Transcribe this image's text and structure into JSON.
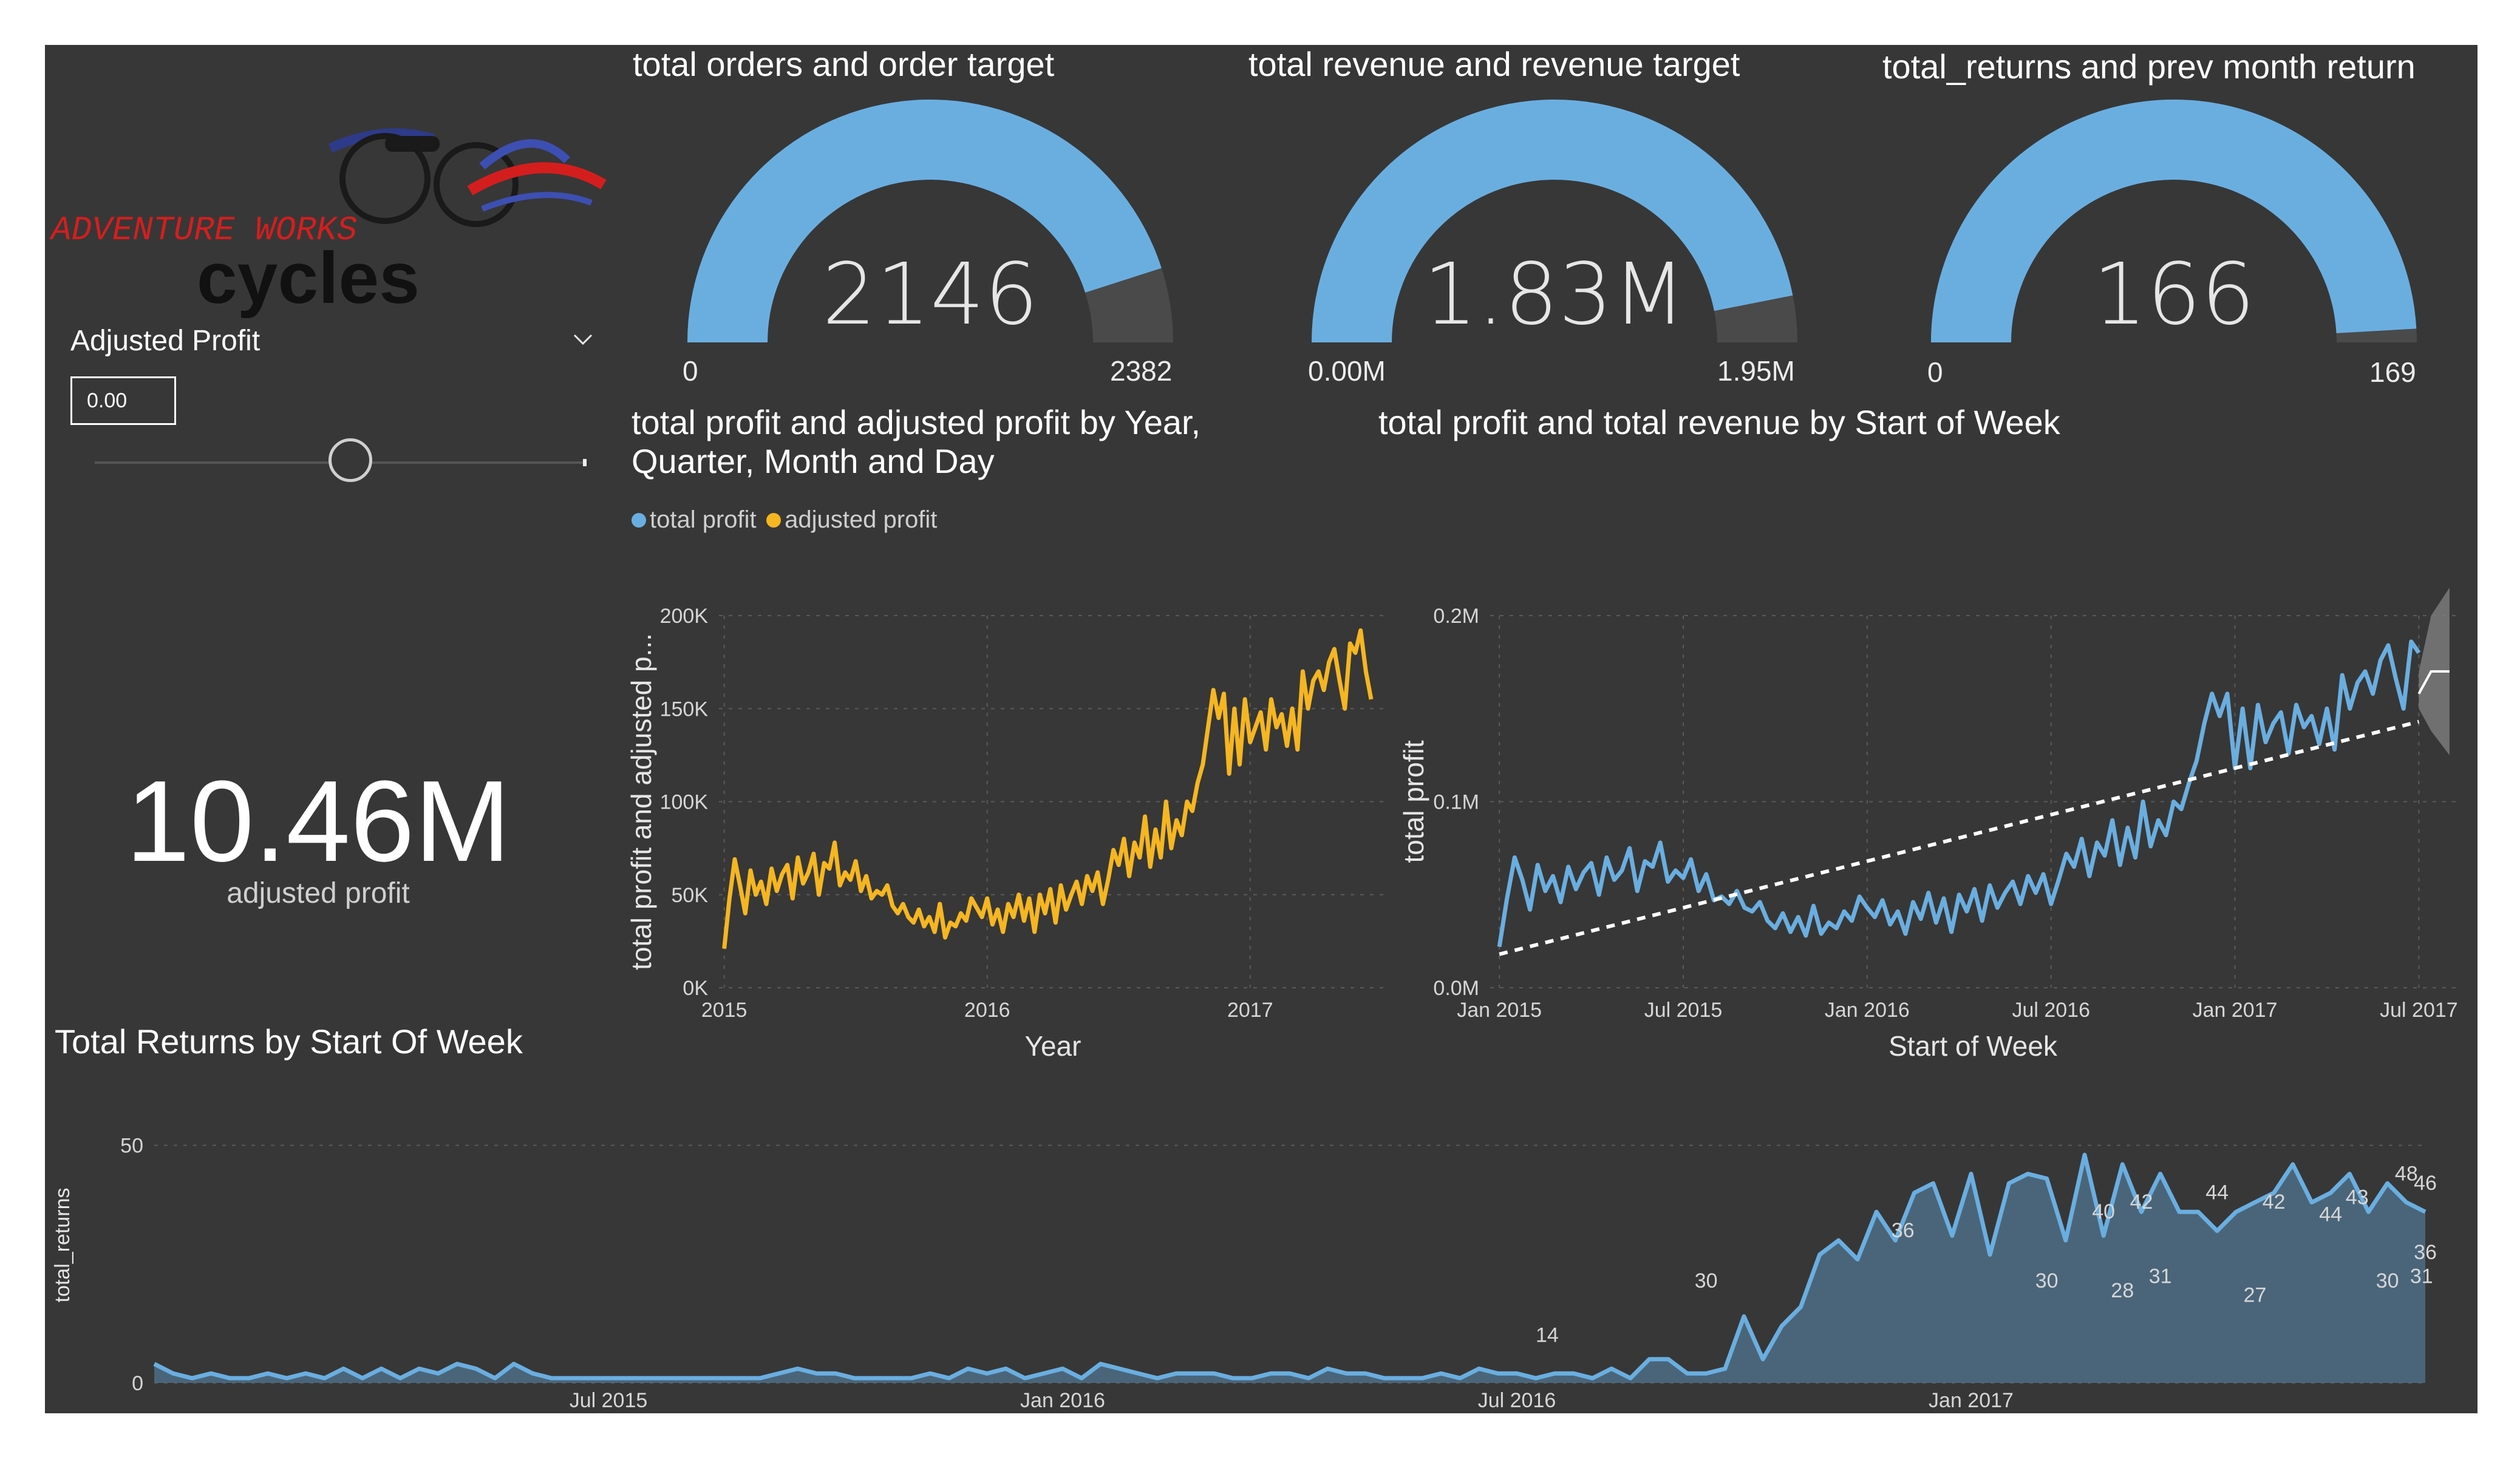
{
  "logo": {
    "line1": "ADVENTURE WORKS",
    "line2": "cycles"
  },
  "slicer": {
    "label": "Adjusted Profit",
    "value": "0.00",
    "slider_fraction": 0.52
  },
  "kpi": {
    "value": "10.46M",
    "label": "adjusted profit"
  },
  "gauges": [
    {
      "title": "total orders and order target",
      "value": "2146",
      "min": "0",
      "max": "2382",
      "fraction": 0.901
    },
    {
      "title": "total revenue and revenue target",
      "value": "1.83M",
      "min": "0.00M",
      "max": "1.95M",
      "fraction": 0.938
    },
    {
      "title": "total_returns and prev month return",
      "value": "166",
      "min": "0",
      "max": "169",
      "fraction": 0.982
    }
  ],
  "colors": {
    "blue": "#6aaee0",
    "gold": "#f5b621",
    "bg": "#373737",
    "area": "#4d6a82"
  },
  "chart_data": [
    {
      "type": "line",
      "title": "total profit and adjusted profit by Year, Quarter, Month and Day",
      "xlabel": "Year",
      "ylabel": "total profit and adjusted p...",
      "legend": [
        "total profit",
        "adjusted profit"
      ],
      "x_ticks": [
        "2015",
        "2016",
        "2017"
      ],
      "y_ticks": [
        "0K",
        "50K",
        "100K",
        "150K",
        "200K"
      ],
      "ylim": [
        0,
        200000
      ],
      "xlim": [
        2014.98,
        2017.52
      ],
      "series": [
        {
          "name": "adjusted profit",
          "color": "#f5b621",
          "x": [
            2015.0,
            2015.02,
            2015.04,
            2015.06,
            2015.08,
            2015.1,
            2015.12,
            2015.14,
            2015.16,
            2015.18,
            2015.2,
            2015.22,
            2015.24,
            2015.26,
            2015.28,
            2015.3,
            2015.32,
            2015.34,
            2015.36,
            2015.38,
            2015.4,
            2015.42,
            2015.44,
            2015.46,
            2015.48,
            2015.5,
            2015.52,
            2015.54,
            2015.56,
            2015.58,
            2015.6,
            2015.62,
            2015.64,
            2015.66,
            2015.68,
            2015.7,
            2015.72,
            2015.74,
            2015.76,
            2015.78,
            2015.8,
            2015.82,
            2015.84,
            2015.86,
            2015.88,
            2015.9,
            2015.92,
            2015.94,
            2015.96,
            2015.98,
            2016.0,
            2016.02,
            2016.04,
            2016.06,
            2016.08,
            2016.1,
            2016.12,
            2016.14,
            2016.16,
            2016.18,
            2016.2,
            2016.22,
            2016.24,
            2016.26,
            2016.28,
            2016.3,
            2016.32,
            2016.34,
            2016.36,
            2016.38,
            2016.4,
            2016.42,
            2016.44,
            2016.46,
            2016.48,
            2016.5,
            2016.52,
            2016.54,
            2016.56,
            2016.58,
            2016.6,
            2016.62,
            2016.64,
            2016.66,
            2016.68,
            2016.7,
            2016.72,
            2016.74,
            2016.76,
            2016.78,
            2016.8,
            2016.82,
            2016.84,
            2016.86,
            2016.88,
            2016.9,
            2016.92,
            2016.94,
            2016.96,
            2016.98,
            2017.0,
            2017.02,
            2017.04,
            2017.06,
            2017.08,
            2017.1,
            2017.12,
            2017.14,
            2017.16,
            2017.18,
            2017.2,
            2017.22,
            2017.24,
            2017.26,
            2017.28,
            2017.3,
            2017.32,
            2017.34,
            2017.36,
            2017.38,
            2017.4,
            2017.42,
            2017.44,
            2017.46
          ],
          "values": [
            21000,
            48000,
            69000,
            55000,
            40000,
            63000,
            50000,
            57000,
            45000,
            64000,
            52000,
            61000,
            66000,
            48000,
            70000,
            56000,
            62000,
            72000,
            50000,
            67000,
            64000,
            78000,
            55000,
            62000,
            58000,
            68000,
            52000,
            60000,
            48000,
            52000,
            50000,
            55000,
            44000,
            40000,
            45000,
            38000,
            35000,
            42000,
            33000,
            38000,
            30000,
            45000,
            27000,
            35000,
            33000,
            40000,
            36000,
            48000,
            43000,
            38000,
            48000,
            34000,
            42000,
            30000,
            45000,
            38000,
            50000,
            36000,
            48000,
            30000,
            50000,
            40000,
            53000,
            35000,
            55000,
            42000,
            50000,
            57000,
            45000,
            60000,
            52000,
            62000,
            45000,
            58000,
            74000,
            66000,
            80000,
            60000,
            78000,
            70000,
            92000,
            65000,
            85000,
            70000,
            100000,
            75000,
            90000,
            82000,
            100000,
            95000,
            110000,
            120000,
            140000,
            160000,
            145000,
            158000,
            115000,
            150000,
            120000,
            155000,
            132000,
            140000,
            148000,
            128000,
            155000,
            140000,
            147000,
            130000,
            150000,
            128000,
            170000,
            150000,
            165000,
            170000,
            160000,
            175000,
            182000,
            165000,
            150000,
            185000,
            180000,
            192000,
            170000,
            155000
          ]
        }
      ]
    },
    {
      "type": "line",
      "title": "total profit and total revenue by Start of Week",
      "xlabel": "Start of Week",
      "ylabel": "total profit",
      "x_ticks": [
        "Jan 2015",
        "Jul 2015",
        "Jan 2016",
        "Jul 2016",
        "Jan 2017",
        "Jul 2017"
      ],
      "y_ticks": [
        "0.0M",
        "0.1M",
        "0.2M"
      ],
      "ylim": [
        0,
        200000
      ],
      "xlim": [
        -0.3,
        31.2
      ],
      "x_units": "months since Jan 2015",
      "series": [
        {
          "name": "total profit",
          "color": "#6aaee0",
          "x": [
            0,
            0.25,
            0.5,
            0.75,
            1,
            1.25,
            1.5,
            1.75,
            2,
            2.25,
            2.5,
            2.75,
            3,
            3.25,
            3.5,
            3.75,
            4,
            4.25,
            4.5,
            4.75,
            5,
            5.25,
            5.5,
            5.75,
            6,
            6.25,
            6.5,
            6.75,
            7,
            7.25,
            7.5,
            7.75,
            8,
            8.25,
            8.5,
            8.75,
            9,
            9.25,
            9.5,
            9.75,
            10,
            10.25,
            10.5,
            10.75,
            11,
            11.25,
            11.5,
            11.75,
            12,
            12.25,
            12.5,
            12.75,
            13,
            13.25,
            13.5,
            13.75,
            14,
            14.25,
            14.5,
            14.75,
            15,
            15.25,
            15.5,
            15.75,
            16,
            16.25,
            16.5,
            16.75,
            17,
            17.25,
            17.5,
            17.75,
            18,
            18.25,
            18.5,
            18.75,
            19,
            19.25,
            19.5,
            19.75,
            20,
            20.25,
            20.5,
            20.75,
            21,
            21.25,
            21.5,
            21.75,
            22,
            22.25,
            22.5,
            22.75,
            23,
            23.25,
            23.5,
            23.75,
            24,
            24.25,
            24.5,
            24.75,
            25,
            25.25,
            25.5,
            25.75,
            26,
            26.25,
            26.5,
            26.75,
            27,
            27.25,
            27.5,
            27.75,
            28,
            28.25,
            28.5,
            28.75,
            29,
            29.25,
            29.5,
            29.75,
            30
          ],
          "values": [
            22000,
            48000,
            70000,
            58000,
            42000,
            66000,
            52000,
            60000,
            46000,
            65000,
            53000,
            62000,
            67000,
            50000,
            70000,
            58000,
            63000,
            75000,
            52000,
            68000,
            65000,
            78000,
            57000,
            63000,
            59000,
            69000,
            52000,
            61000,
            47000,
            49000,
            45000,
            52000,
            43000,
            41000,
            46000,
            36000,
            32000,
            40000,
            30000,
            38000,
            28000,
            44000,
            29000,
            35000,
            32000,
            41000,
            36000,
            49000,
            43000,
            38000,
            47000,
            34000,
            41000,
            29000,
            46000,
            37000,
            51000,
            35000,
            48000,
            30000,
            50000,
            41000,
            53000,
            36000,
            55000,
            43000,
            51000,
            57000,
            45000,
            60000,
            51000,
            61000,
            45000,
            58000,
            72000,
            65000,
            80000,
            60000,
            78000,
            71000,
            90000,
            66000,
            86000,
            70000,
            100000,
            76000,
            90000,
            82000,
            100000,
            96000,
            110000,
            122000,
            142000,
            158000,
            146000,
            158000,
            118000,
            150000,
            118000,
            152000,
            132000,
            142000,
            148000,
            126000,
            152000,
            140000,
            146000,
            131000,
            150000,
            128000,
            168000,
            150000,
            164000,
            170000,
            158000,
            176000,
            184000,
            166000,
            150000,
            186000,
            180000
          ]
        },
        {
          "name": "forecast",
          "color": "#ffffff",
          "x": [
            30,
            30.4,
            31.0
          ],
          "values": [
            158000,
            170000,
            170000
          ],
          "band_upper": [
            170000,
            200000,
            215000
          ],
          "band_lower": [
            150000,
            138000,
            125000
          ]
        },
        {
          "name": "trend",
          "color": "#ffffff",
          "dashed": true,
          "x": [
            0,
            30
          ],
          "values": [
            18000,
            143000
          ]
        }
      ]
    },
    {
      "type": "area",
      "title": "Total Returns by Start Of Week",
      "xlabel": "Start of Week",
      "ylabel": "total_returns",
      "x_ticks": [
        "Jul 2015",
        "Jan 2016",
        "Jul 2016",
        "Jan 2017"
      ],
      "y_ticks": [
        "0",
        "50"
      ],
      "ylim": [
        0,
        58
      ],
      "xlim": [
        0,
        30
      ],
      "x_units": "months since Jan 2015",
      "series": [
        {
          "name": "total_returns",
          "color": "#6aaee0",
          "x": [
            0,
            0.25,
            0.5,
            0.75,
            1,
            1.25,
            1.5,
            1.75,
            2,
            2.25,
            2.5,
            2.75,
            3,
            3.25,
            3.5,
            3.75,
            4,
            4.25,
            4.5,
            4.75,
            5,
            5.25,
            5.5,
            5.75,
            6,
            6.25,
            6.5,
            6.75,
            7,
            7.25,
            7.5,
            7.75,
            8,
            8.25,
            8.5,
            8.75,
            9,
            9.25,
            9.5,
            9.75,
            10,
            10.25,
            10.5,
            10.75,
            11,
            11.25,
            11.5,
            11.75,
            12,
            12.25,
            12.5,
            12.75,
            13,
            13.25,
            13.5,
            13.75,
            14,
            14.25,
            14.5,
            14.75,
            15,
            15.25,
            15.5,
            15.75,
            16,
            16.25,
            16.5,
            16.75,
            17,
            17.25,
            17.5,
            17.75,
            18,
            18.25,
            18.5,
            18.75,
            19,
            19.25,
            19.5,
            19.75,
            20,
            20.25,
            20.5,
            20.75,
            21,
            21.25,
            21.5,
            21.75,
            22,
            22.25,
            22.5,
            22.75,
            23,
            23.25,
            23.5,
            23.75,
            24,
            24.25,
            24.5,
            24.75,
            25,
            25.25,
            25.5,
            25.75,
            26,
            26.25,
            26.5,
            26.75,
            27,
            27.25,
            27.5,
            27.75,
            28,
            28.25,
            28.5,
            28.75,
            29,
            29.25,
            29.5,
            29.75,
            30
          ],
          "values": [
            4,
            2,
            1,
            2,
            1,
            1,
            2,
            1,
            2,
            1,
            3,
            1,
            3,
            1,
            3,
            2,
            4,
            3,
            1,
            4,
            2,
            1,
            1,
            1,
            1,
            1,
            1,
            1,
            1,
            1,
            1,
            1,
            1,
            2,
            3,
            2,
            2,
            1,
            1,
            1,
            1,
            2,
            1,
            3,
            2,
            3,
            1,
            2,
            3,
            1,
            4,
            3,
            2,
            1,
            2,
            2,
            2,
            1,
            1,
            2,
            2,
            1,
            3,
            2,
            2,
            1,
            1,
            1,
            2,
            1,
            3,
            2,
            2,
            1,
            2,
            2,
            1,
            3,
            1,
            5,
            5,
            2,
            2,
            3,
            14,
            5,
            12,
            16,
            27,
            30,
            26,
            36,
            30,
            40,
            42,
            31,
            44,
            27,
            42,
            44,
            43,
            30,
            48,
            31,
            46,
            36,
            44,
            36,
            36,
            32,
            36,
            38,
            40,
            46,
            38,
            40,
            44,
            36,
            42,
            38,
            36
          ],
          "labels": [
            {
              "x": 18.4,
              "value": 14
            },
            {
              "x": 20.5,
              "value": 30
            },
            {
              "x": 23.1,
              "value": 36
            },
            {
              "x": 25.0,
              "value": 30
            },
            {
              "x": 25.75,
              "value": 40
            },
            {
              "x": 26.0,
              "value": 28
            },
            {
              "x": 26.25,
              "value": 42
            },
            {
              "x": 26.5,
              "value": 31
            },
            {
              "x": 27.25,
              "value": 44
            },
            {
              "x": 27.75,
              "value": 27
            },
            {
              "x": 28.0,
              "value": 42
            },
            {
              "x": 28.75,
              "value": 44
            },
            {
              "x": 29.1,
              "value": 43
            },
            {
              "x": 29.5,
              "value": 30
            },
            {
              "x": 29.75,
              "value": 48
            },
            {
              "x": 29.95,
              "value": 31
            },
            {
              "x": 30.0,
              "value": 46
            },
            {
              "x": 30.0,
              "value": 36
            }
          ]
        }
      ]
    }
  ]
}
